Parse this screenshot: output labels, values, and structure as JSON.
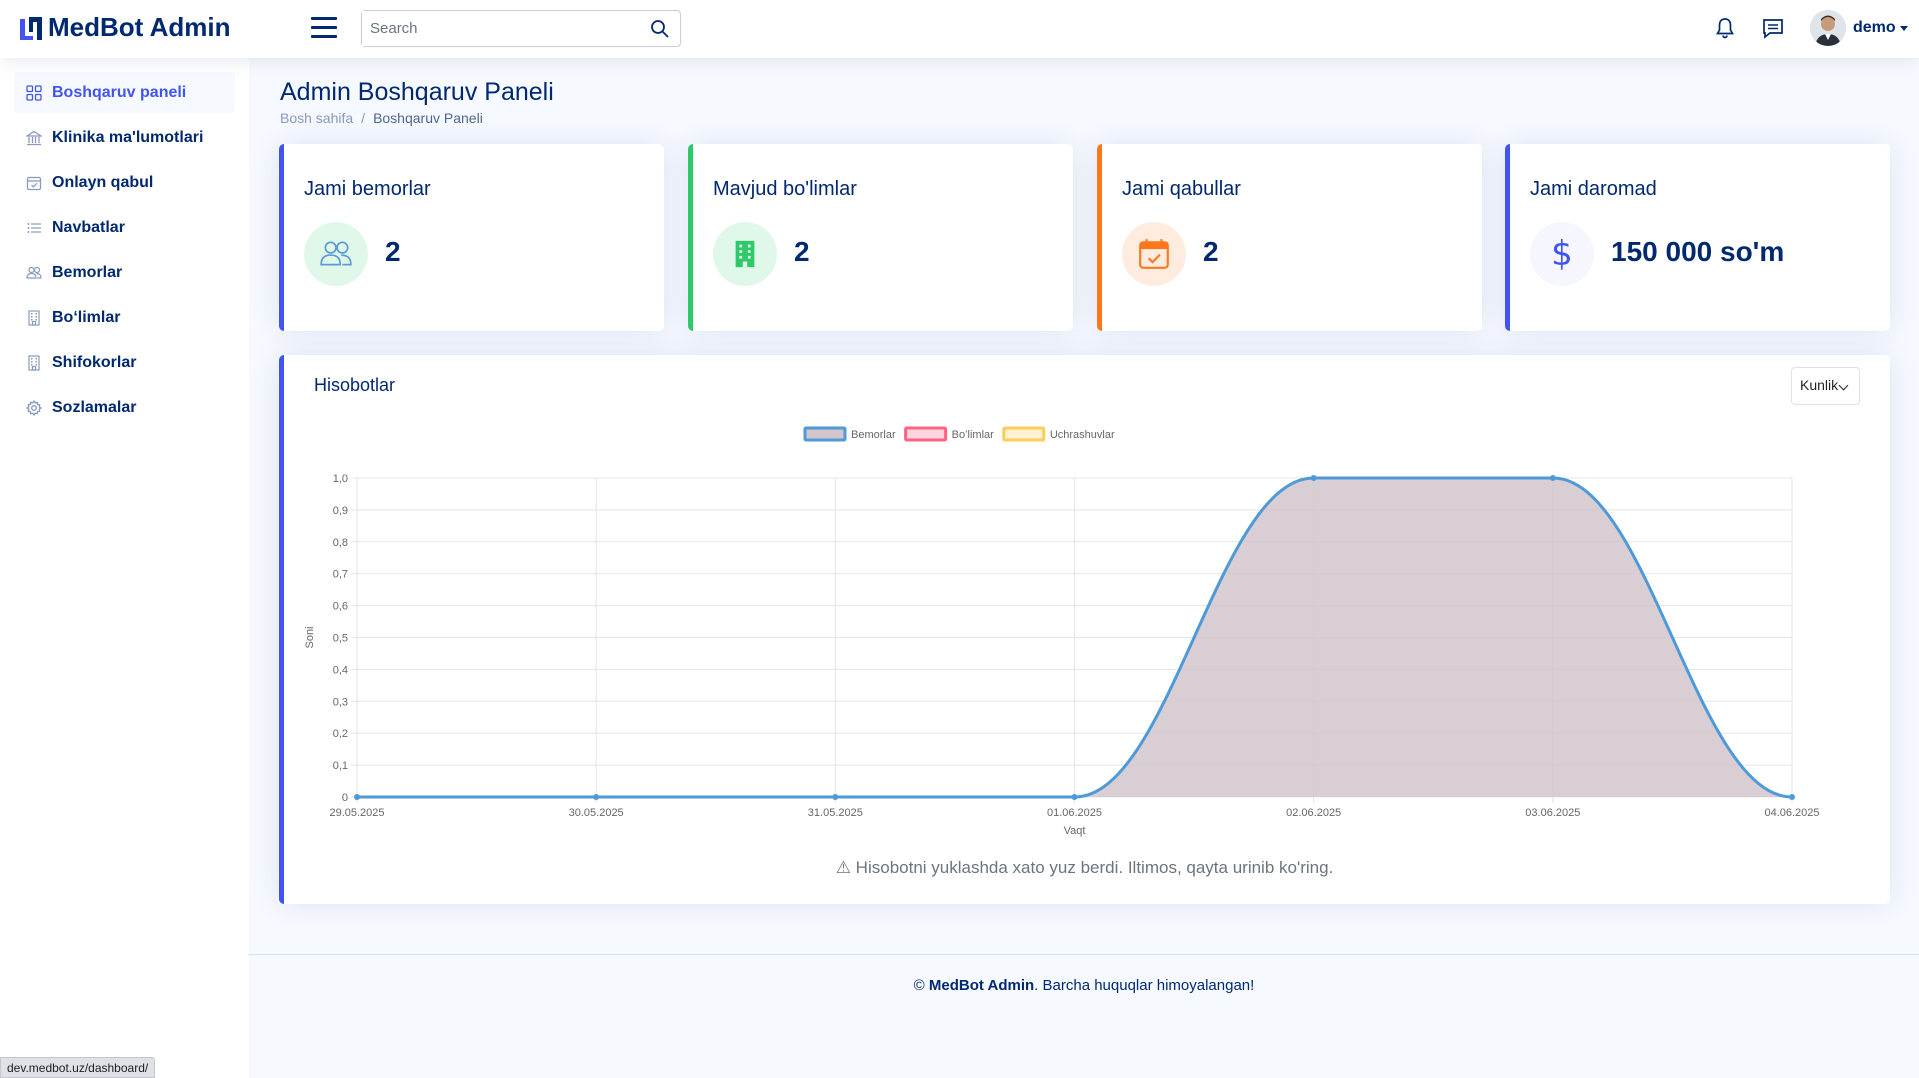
{
  "app": {
    "title": "MedBot Admin"
  },
  "header": {
    "search_placeholder": "Search",
    "user_name": "demo"
  },
  "sidebar": {
    "items": [
      {
        "label": "Boshqaruv paneli",
        "icon": "grid-icon",
        "active": true
      },
      {
        "label": "Klinika ma'lumotlari",
        "icon": "bank-icon"
      },
      {
        "label": "Onlayn qabul",
        "icon": "calendar-check-icon"
      },
      {
        "label": "Navbatlar",
        "icon": "list-icon"
      },
      {
        "label": "Bemorlar",
        "icon": "people-icon"
      },
      {
        "label": "Boʻlimlar",
        "icon": "building-icon"
      },
      {
        "label": "Shifokorlar",
        "icon": "building-icon"
      },
      {
        "label": "Sozlamalar",
        "icon": "gear-icon"
      }
    ]
  },
  "page": {
    "title": "Admin Boshqaruv Paneli",
    "breadcrumb": {
      "home": "Bosh sahifa",
      "separator": "/",
      "current": "Boshqaruv Paneli"
    }
  },
  "stats": [
    {
      "title": "Jami bemorlar",
      "value": "2",
      "icon": "people-icon",
      "accent": "#4154f1",
      "icon_bg": "#e0f8e9",
      "icon_color": "#5b9bd5"
    },
    {
      "title": "Mavjud bo'limlar",
      "value": "2",
      "icon": "building-icon",
      "accent": "#2eca6a",
      "icon_bg": "#e0f8e9",
      "icon_color": "#2eca6a"
    },
    {
      "title": "Jami qabullar",
      "value": "2",
      "icon": "calendar-check-icon",
      "accent": "#ff771d",
      "icon_bg": "#ffecdf",
      "icon_color": "#ff771d"
    },
    {
      "title": "Jami daromad",
      "value": "150 000 so'm",
      "icon": "dollar-icon",
      "accent": "#4154f1",
      "icon_bg": "#f6f6fe",
      "icon_color": "#4154f1"
    }
  ],
  "report": {
    "title": "Hisobotlar",
    "period": "Kunlik",
    "error": "⚠ Hisobotni yuklashda xato yuz berdi. Iltimos, qayta urinib ko'ring."
  },
  "chart_data": {
    "type": "area",
    "x": [
      "29.05.2025",
      "30.05.2025",
      "31.05.2025",
      "01.06.2025",
      "02.06.2025",
      "03.06.2025",
      "04.06.2025"
    ],
    "series": [
      {
        "name": "Bemorlar",
        "values": [
          0,
          0,
          0,
          0,
          1,
          1,
          0
        ],
        "color": "#4e9ad8",
        "fill": "#d2c6cb"
      },
      {
        "name": "Boʻlimlar",
        "values": [],
        "color": "#ff6384",
        "fill": "#ffd6df"
      },
      {
        "name": "Uchrashuvlar",
        "values": [],
        "color": "#ffcd56",
        "fill": "#fff3d6"
      }
    ],
    "yticks": [
      "0",
      "0,1",
      "0,2",
      "0,3",
      "0,4",
      "0,5",
      "0,6",
      "0,7",
      "0,8",
      "0,9",
      "1,0"
    ],
    "ylim": [
      0,
      1
    ],
    "xlabel": "Vaqt",
    "ylabel": "Soni",
    "legend": "top",
    "grid": true
  },
  "footer": {
    "copyright": "©",
    "brand": "MedBot Admin",
    "text": ". Barcha huquqlar himoyalangan!"
  },
  "status_bar": {
    "url": "dev.medbot.uz/dashboard/"
  }
}
